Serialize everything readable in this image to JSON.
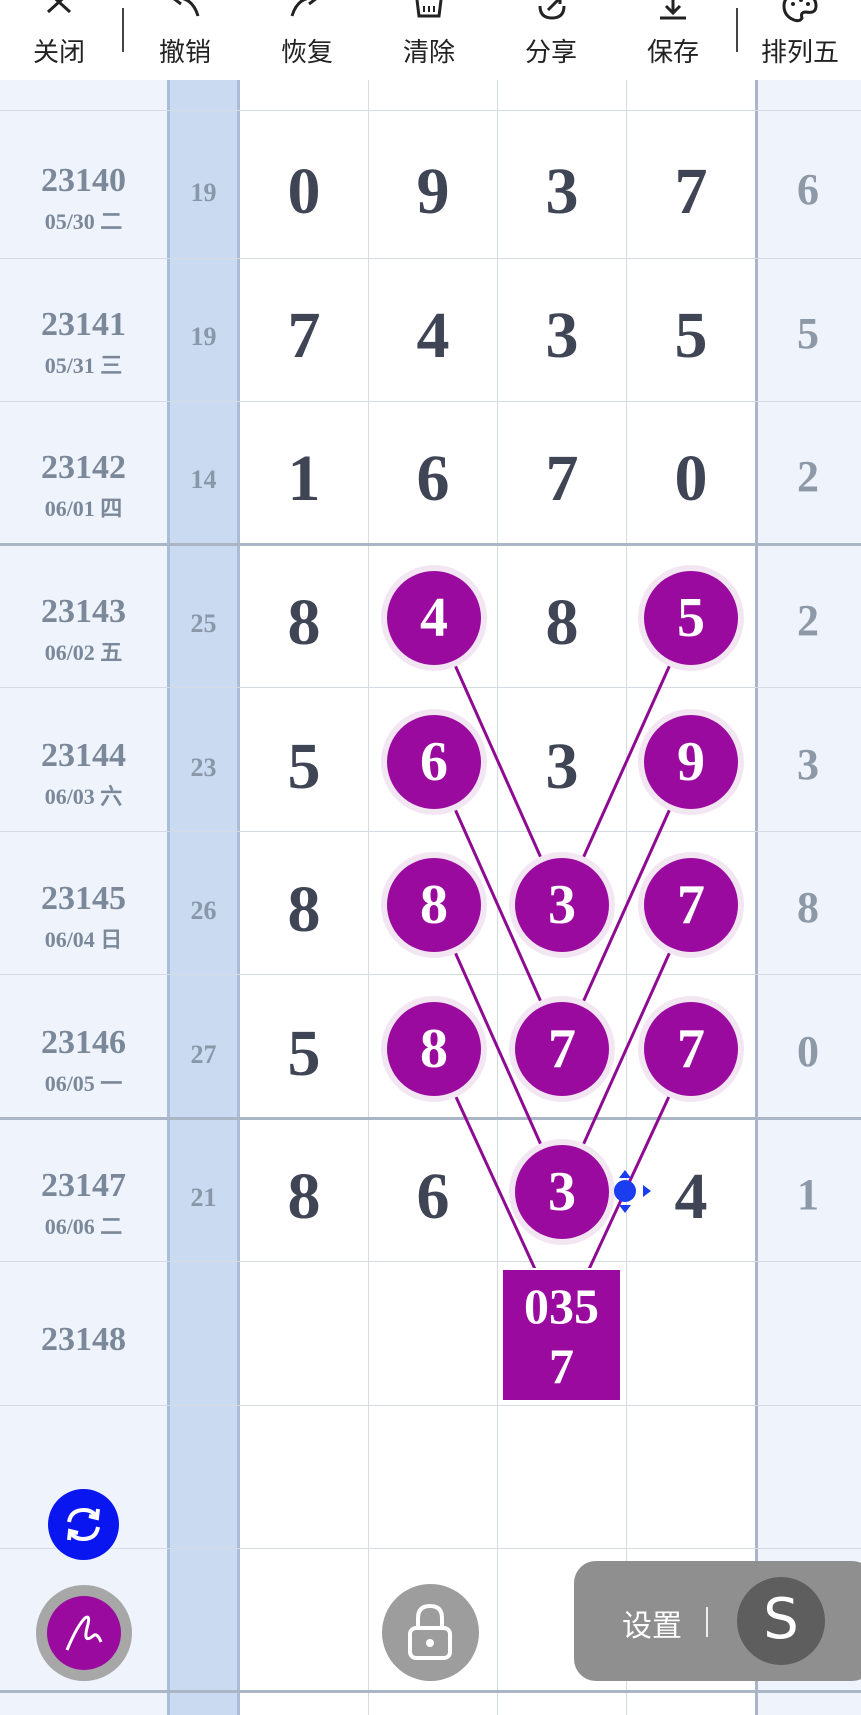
{
  "toolbar": {
    "items": [
      {
        "label": "关闭",
        "icon": "close-icon"
      },
      {
        "label": "撤销",
        "icon": "undo-icon"
      },
      {
        "label": "恢复",
        "icon": "redo-icon"
      },
      {
        "label": "清除",
        "icon": "trash-icon"
      },
      {
        "label": "分享",
        "icon": "share-icon"
      },
      {
        "label": "保存",
        "icon": "download-icon"
      },
      {
        "label": "排列五",
        "icon": "palette-icon"
      }
    ]
  },
  "rows": [
    {
      "period": "23140",
      "date": "05/30 二",
      "sum": "19",
      "digits": [
        "0",
        "9",
        "3",
        "7"
      ],
      "extra": "6"
    },
    {
      "period": "23141",
      "date": "05/31 三",
      "sum": "19",
      "digits": [
        "7",
        "4",
        "3",
        "5"
      ],
      "extra": "5"
    },
    {
      "period": "23142",
      "date": "06/01 四",
      "sum": "14",
      "digits": [
        "1",
        "6",
        "7",
        "0"
      ],
      "extra": "2"
    },
    {
      "period": "23143",
      "date": "06/02 五",
      "sum": "25",
      "digits": [
        "8",
        "4",
        "8",
        "5"
      ],
      "extra": "2"
    },
    {
      "period": "23144",
      "date": "06/03 六",
      "sum": "23",
      "digits": [
        "5",
        "6",
        "3",
        "9"
      ],
      "extra": "3"
    },
    {
      "period": "23145",
      "date": "06/04 日",
      "sum": "26",
      "digits": [
        "8",
        "8",
        "3",
        "7"
      ],
      "extra": "8"
    },
    {
      "period": "23146",
      "date": "06/05 一",
      "sum": "27",
      "digits": [
        "5",
        "8",
        "7",
        "7"
      ],
      "extra": "0"
    },
    {
      "period": "23147",
      "date": "06/06 二",
      "sum": "21",
      "digits": [
        "8",
        "6",
        "3",
        "4"
      ],
      "extra": "1"
    },
    {
      "period": "23148",
      "date": "",
      "sum": "",
      "digits": [
        "",
        "",
        "",
        ""
      ],
      "extra": ""
    }
  ],
  "prediction": {
    "line1": "035",
    "line2": "7"
  },
  "settings": {
    "label": "设置",
    "button": "S"
  },
  "colors": {
    "highlight": "#9b0a9e",
    "sum_column": "#c9daf1",
    "handle": "#1a3df0"
  }
}
